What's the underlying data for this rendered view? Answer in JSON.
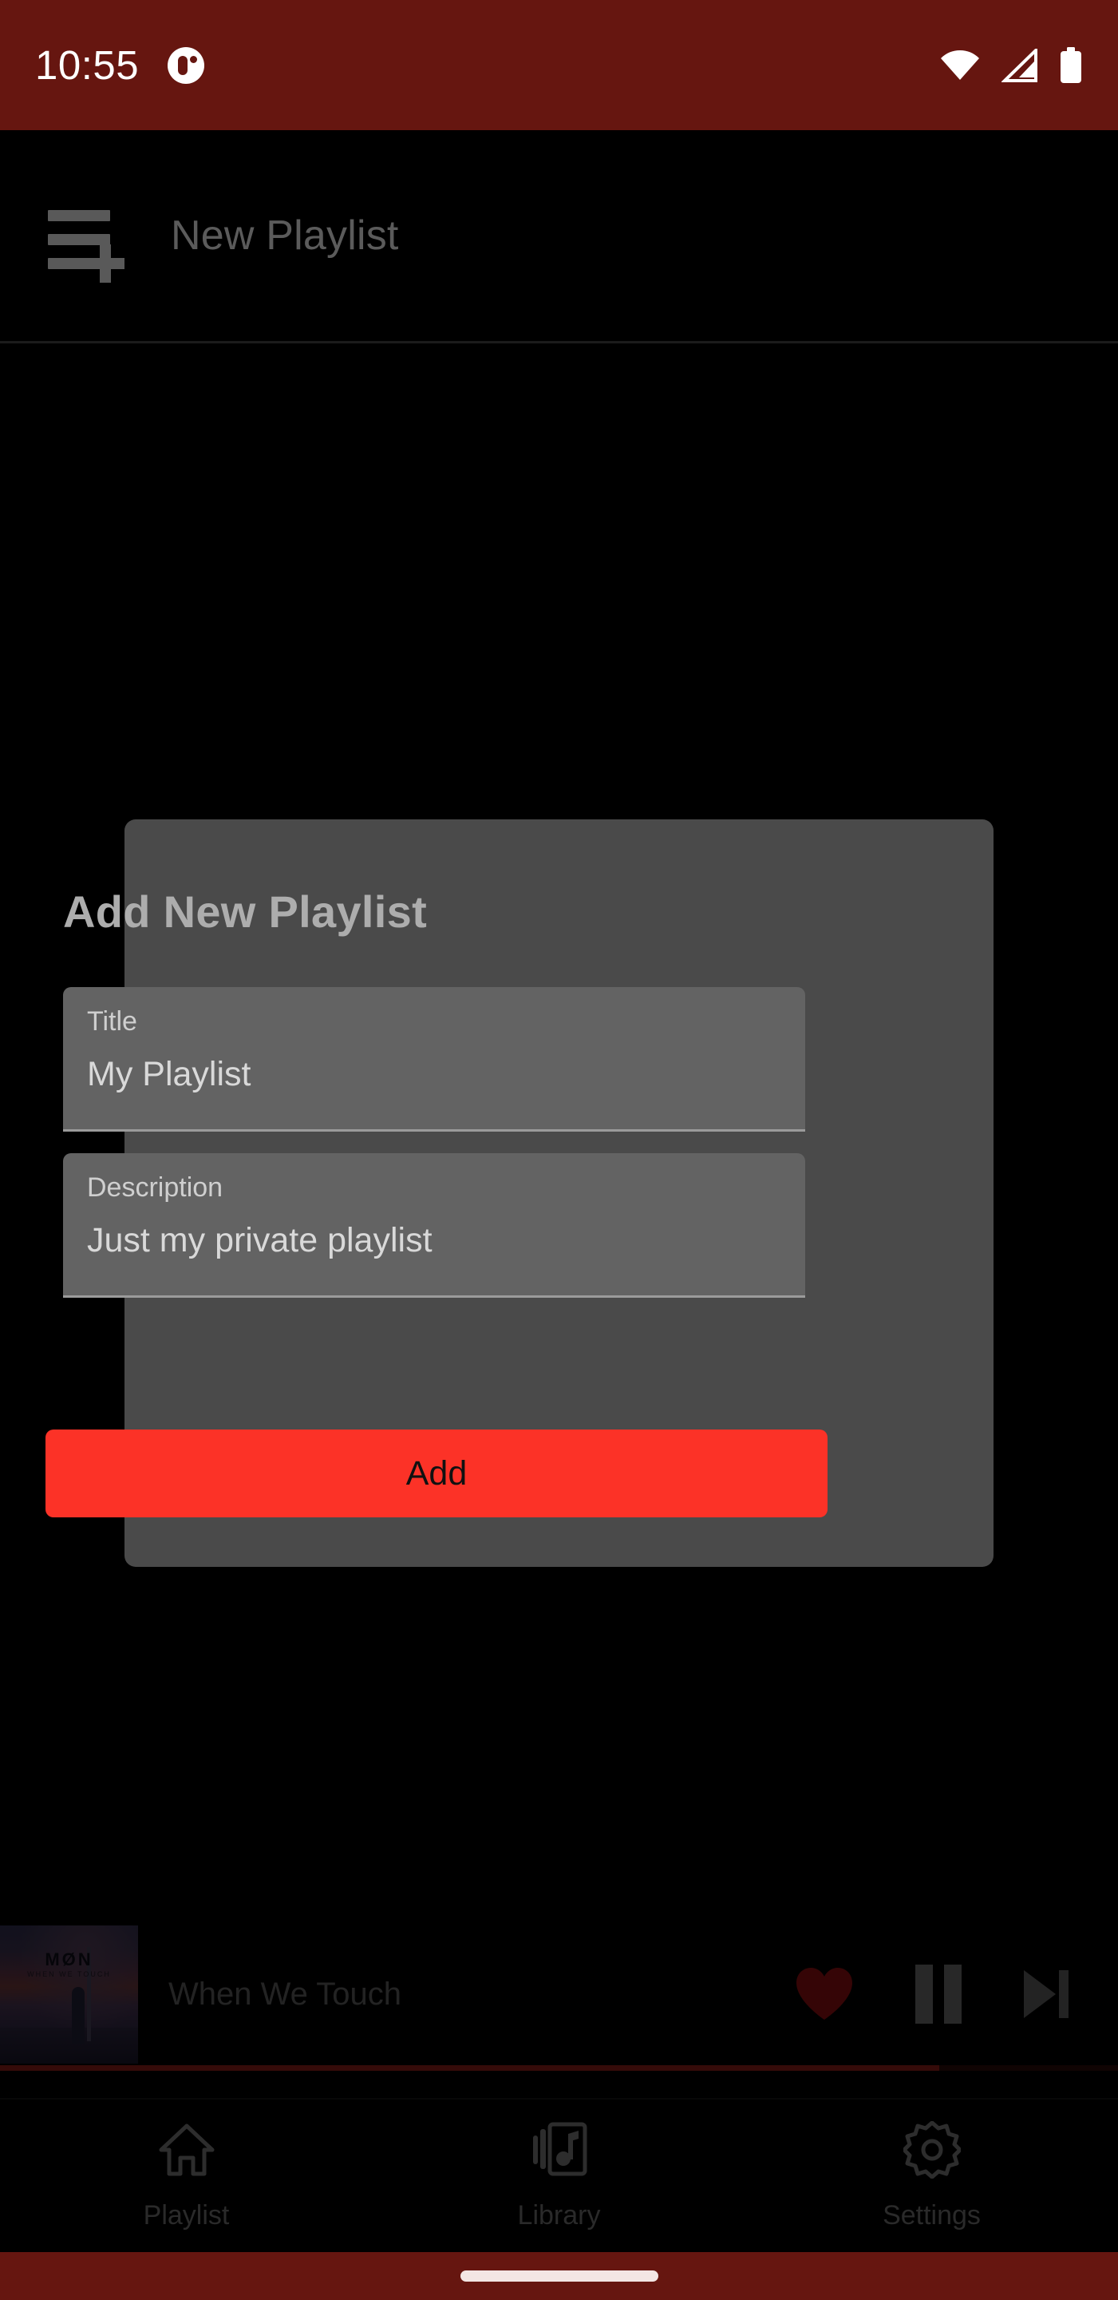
{
  "status_bar": {
    "time": "10:55",
    "background_color": "#661610",
    "icons": [
      "notification-dot-icon",
      "wifi-icon",
      "cellular-signal-icon",
      "battery-icon"
    ]
  },
  "app_bar": {
    "title": "New Playlist",
    "icon": "playlist-add-icon"
  },
  "dialog": {
    "title": "Add New Playlist",
    "fields": [
      {
        "label": "Title",
        "value": "My Playlist",
        "placeholder": "Title"
      },
      {
        "label": "Description",
        "value": "Just my private playlist",
        "placeholder": "Description"
      }
    ],
    "submit_label": "Add",
    "submit_color": "#FC3227",
    "background_color": "#4A4A4A"
  },
  "now_playing": {
    "track_title": "When We Touch",
    "album_art_title": "MØN",
    "album_art_subtitle": "WHEN WE TOUCH",
    "favorite_icon": "heart-filled-icon",
    "favorite_color": "#8B0F10",
    "play_state_icon": "pause-icon",
    "next_icon": "skip-next-icon",
    "progress_percent": 84
  },
  "bottom_nav": {
    "items": [
      {
        "label": "Playlist",
        "icon": "home-icon"
      },
      {
        "label": "Library",
        "icon": "library-music-icon"
      },
      {
        "label": "Settings",
        "icon": "gear-icon"
      }
    ]
  },
  "gesture_bar": {
    "background_color": "#661610"
  }
}
